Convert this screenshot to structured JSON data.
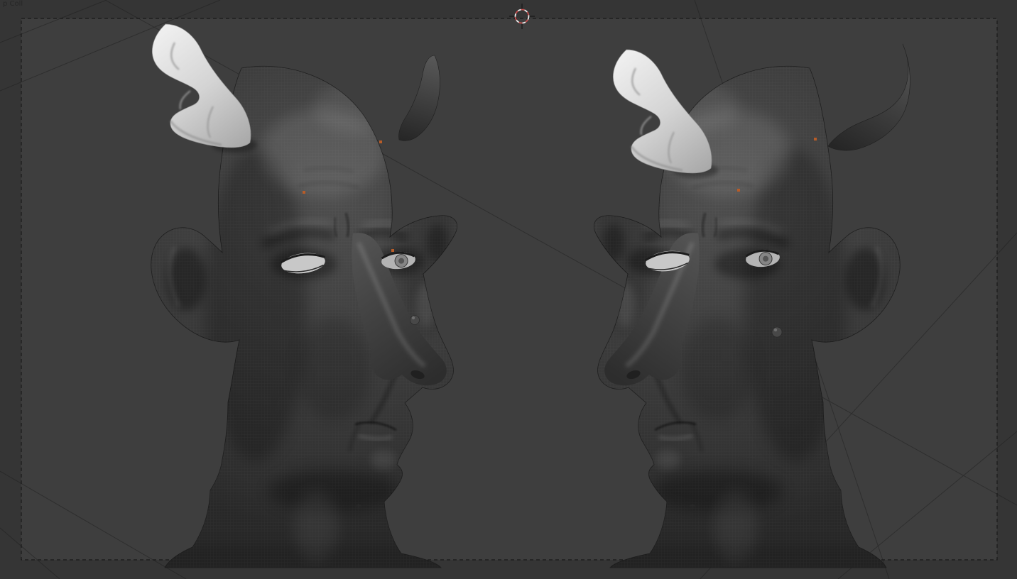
{
  "viewport": {
    "corner_label": "p Coll",
    "colors": {
      "outer_bg": "#353535",
      "inner_bg": "#3e3e3e",
      "border": "#191919",
      "line": "#1f1f1f",
      "skin_base": "#414141",
      "skin_shadow": "#262626",
      "skin_highlight": "#6a6a6a",
      "horn_white": "#d9d9d9",
      "horn_dark": "#353535",
      "eye_white": "#c8c8c8",
      "iris": "#858585",
      "cursor_red": "#c94f4f",
      "cursor_white": "#ededed",
      "marker_orange": "#b85c28",
      "label_text": "#262626"
    },
    "objects": [
      "demon-bust-left",
      "demon-bust-right"
    ]
  }
}
